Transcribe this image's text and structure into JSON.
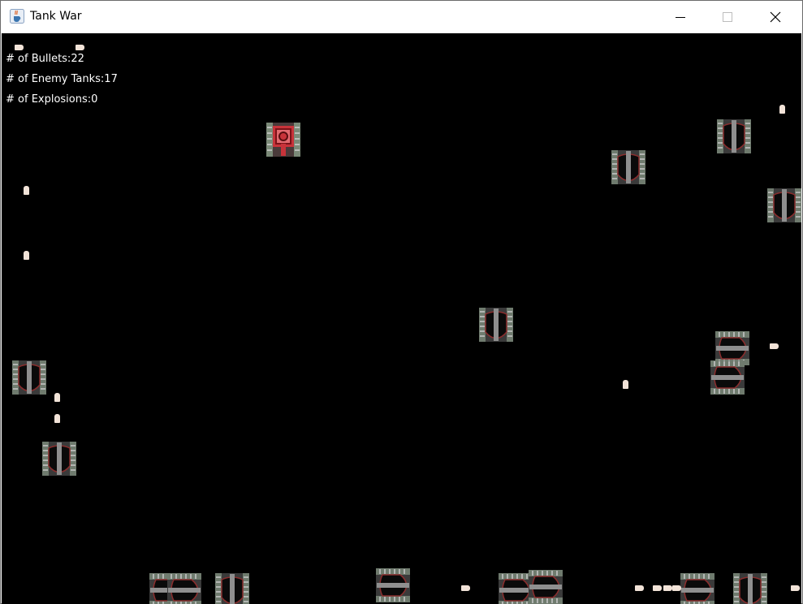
{
  "window": {
    "title": "Tank War",
    "icon": "java-coffee-icon",
    "controls": [
      "minimize-icon",
      "maximize-icon",
      "close-icon"
    ]
  },
  "hud": {
    "bullets": "# of Bullets:22",
    "enemy_tanks": "# of Enemy Tanks:17",
    "explosions": "# of Explosions:0"
  },
  "colors": {
    "background": "#000000",
    "hud_text": "#ffffff",
    "player_tank": "#c8333a",
    "enemy_tank": "#7a7a7a",
    "bullet": "#f2e3d8"
  }
}
